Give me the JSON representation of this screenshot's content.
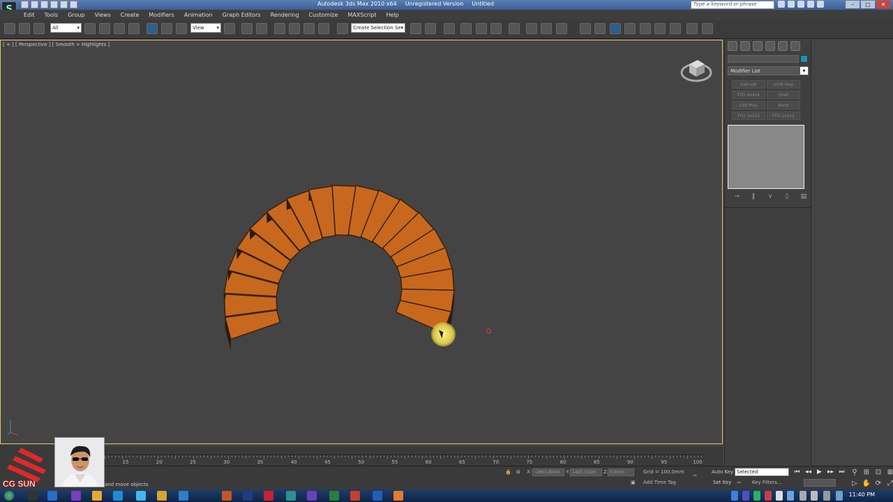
{
  "app": {
    "title": "Autodesk 3ds Max 2010 x64",
    "license": "Unregistered Version",
    "file": "Untitled",
    "search_placeholder": "Type a keyword or phrase"
  },
  "menu": [
    "Edit",
    "Tools",
    "Group",
    "Views",
    "Create",
    "Modifiers",
    "Animation",
    "Graph Editors",
    "Rendering",
    "Customize",
    "MAXScript",
    "Help"
  ],
  "toolbar": {
    "filter_dropdown": "All",
    "refcoord_dropdown": "View",
    "selection_set_dropdown": "Create Selection Se"
  },
  "viewport": {
    "label": "[ + ] [ Perspective ] [ Smooth + Highlights ]",
    "object_color": "#c8681e",
    "background": "#444444"
  },
  "command_panel": {
    "modifier_list": "Modifier List",
    "modifier_buttons": [
      "Extrude",
      "UVW Map",
      "FFD 4x4x4",
      "Shell",
      "Edit Poly",
      "Bend",
      "FFD 3x3x3",
      "FFD 2x2x2"
    ],
    "swatch_color": "#1e8fb0"
  },
  "timeline": {
    "ticks": [
      15,
      20,
      25,
      30,
      35,
      40,
      45,
      50,
      55,
      60,
      65,
      70,
      75,
      80,
      85,
      90,
      95,
      100
    ]
  },
  "status": {
    "prompt": "and move objects",
    "x_label": "X:",
    "x_value": "-2863.404m",
    "y_label": "Y:",
    "y_value": "1405.316m",
    "z_label": "Z:",
    "z_value": "0.0mm",
    "grid": "Grid = 100.0mm",
    "add_time_tag": "Add Time Tag",
    "auto_key": "Auto Key",
    "set_key": "Set Key",
    "selected": "Selected",
    "key_filters": "Key Filters..."
  },
  "taskbar": {
    "clock": "11:40 PM"
  },
  "overlay": {
    "brand_text": "CG SUN"
  }
}
